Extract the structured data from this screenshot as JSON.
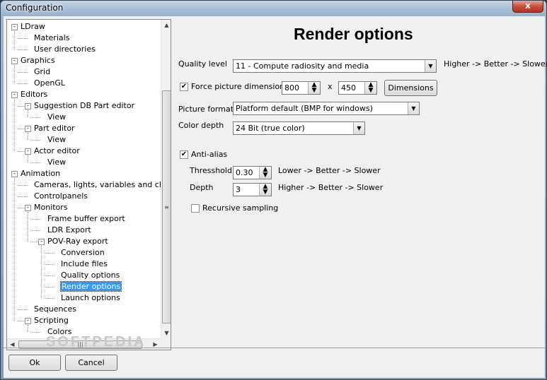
{
  "window": {
    "title": "Configuration",
    "close_glyph": "x"
  },
  "tree": {
    "items": [
      {
        "label": "LDraw",
        "level": 0,
        "expander": "-"
      },
      {
        "label": "Materials",
        "level": 1
      },
      {
        "label": "User directories",
        "level": 1
      },
      {
        "label": "Graphics",
        "level": 0,
        "expander": "-"
      },
      {
        "label": "Grid",
        "level": 1
      },
      {
        "label": "OpenGL",
        "level": 1
      },
      {
        "label": "Editors",
        "level": 0,
        "expander": "-"
      },
      {
        "label": "Suggestion DB Part editor",
        "level": 1,
        "expander": "-"
      },
      {
        "label": "View",
        "level": 2
      },
      {
        "label": "Part editor",
        "level": 1,
        "expander": "-"
      },
      {
        "label": "View",
        "level": 2
      },
      {
        "label": "Actor editor",
        "level": 1,
        "expander": "-"
      },
      {
        "label": "View",
        "level": 2
      },
      {
        "label": "Animation",
        "level": 0,
        "expander": "-"
      },
      {
        "label": "Cameras, lights, variables and chara",
        "level": 1
      },
      {
        "label": "Controlpanels",
        "level": 1
      },
      {
        "label": "Monitors",
        "level": 1,
        "expander": "-"
      },
      {
        "label": "Frame buffer export",
        "level": 2
      },
      {
        "label": "LDR Export",
        "level": 2
      },
      {
        "label": "POV-Ray export",
        "level": 2,
        "expander": "-"
      },
      {
        "label": "Conversion",
        "level": 3
      },
      {
        "label": "Include files",
        "level": 3
      },
      {
        "label": "Quality options",
        "level": 3
      },
      {
        "label": "Render options",
        "level": 3,
        "selected": true
      },
      {
        "label": "Launch options",
        "level": 3
      },
      {
        "label": "Sequences",
        "level": 1
      },
      {
        "label": "Scripting",
        "level": 1,
        "expander": "-"
      },
      {
        "label": "Colors",
        "level": 2
      }
    ]
  },
  "panel": {
    "title": "Render options",
    "quality": {
      "label": "Quality level",
      "value": "11 - Compute radiosity and media",
      "hint": "Higher -> Better -> Slower"
    },
    "force_dimensions": {
      "label": "Force picture dimensions",
      "checked": true,
      "width": "800",
      "times": "x",
      "height": "450",
      "button": "Dimensions"
    },
    "picture_format": {
      "label": "Picture format",
      "value": "Platform default (BMP for windows)"
    },
    "color_depth": {
      "label": "Color depth",
      "value": "24 Bit (true color)"
    },
    "anti_alias": {
      "label": "Anti-alias",
      "checked": true,
      "threshold_label": "Thresshold",
      "threshold_value": "0.30",
      "threshold_hint": "Lower -> Better -> Slower",
      "depth_label": "Depth",
      "depth_value": "3",
      "depth_hint": "Higher -> Better -> Slower"
    },
    "recursive": {
      "label": "Recursive sampling",
      "checked": false
    }
  },
  "buttons": {
    "ok": "Ok",
    "cancel": "Cancel"
  },
  "watermark": "SOFTPEDIA",
  "icons": {
    "check": "check-icon",
    "spin": "spin-arrows-icon",
    "dropdown": "chevron-down-icon"
  }
}
